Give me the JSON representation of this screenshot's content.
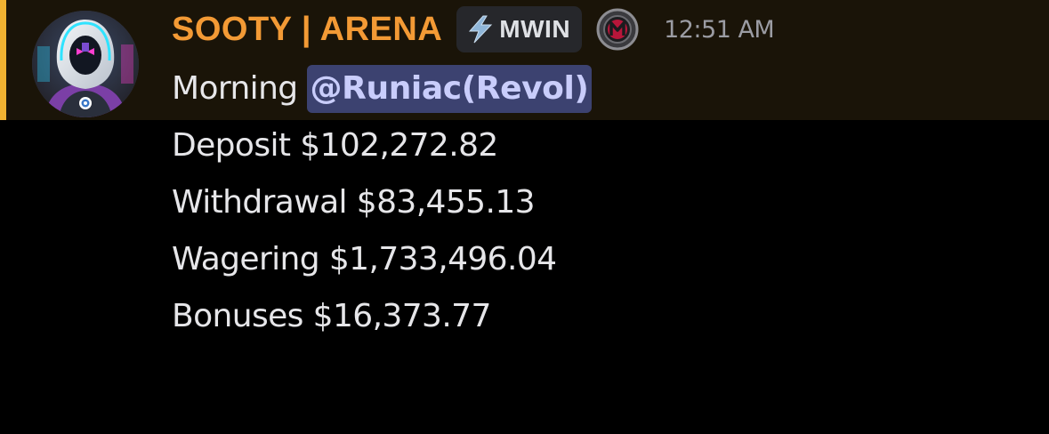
{
  "message": {
    "author": {
      "name": "SOOTY | ARENA",
      "avatar_icon": "hooded-cyber-character-avatar",
      "name_color": "#f39a35"
    },
    "tag": {
      "icon": "lightning-bolt-icon",
      "label": "MWIN"
    },
    "role_icon": "m-logo-badge-icon",
    "timestamp": "12:51 AM",
    "greeting": "Morning",
    "mention": "@Runiac(Revol)",
    "lines": [
      "Deposit $102,272.82",
      "Withdrawal $83,455.13",
      "Wagering $1,733,496.04",
      "Bonuses $16,373.77"
    ],
    "colors": {
      "highlight_bar": "#f0b232",
      "highlight_background": "#1a1408",
      "mention_background": "#3c4270",
      "mention_text": "#c9cdfb",
      "text": "#e6e6e9",
      "timestamp": "#9b9ca3"
    }
  }
}
